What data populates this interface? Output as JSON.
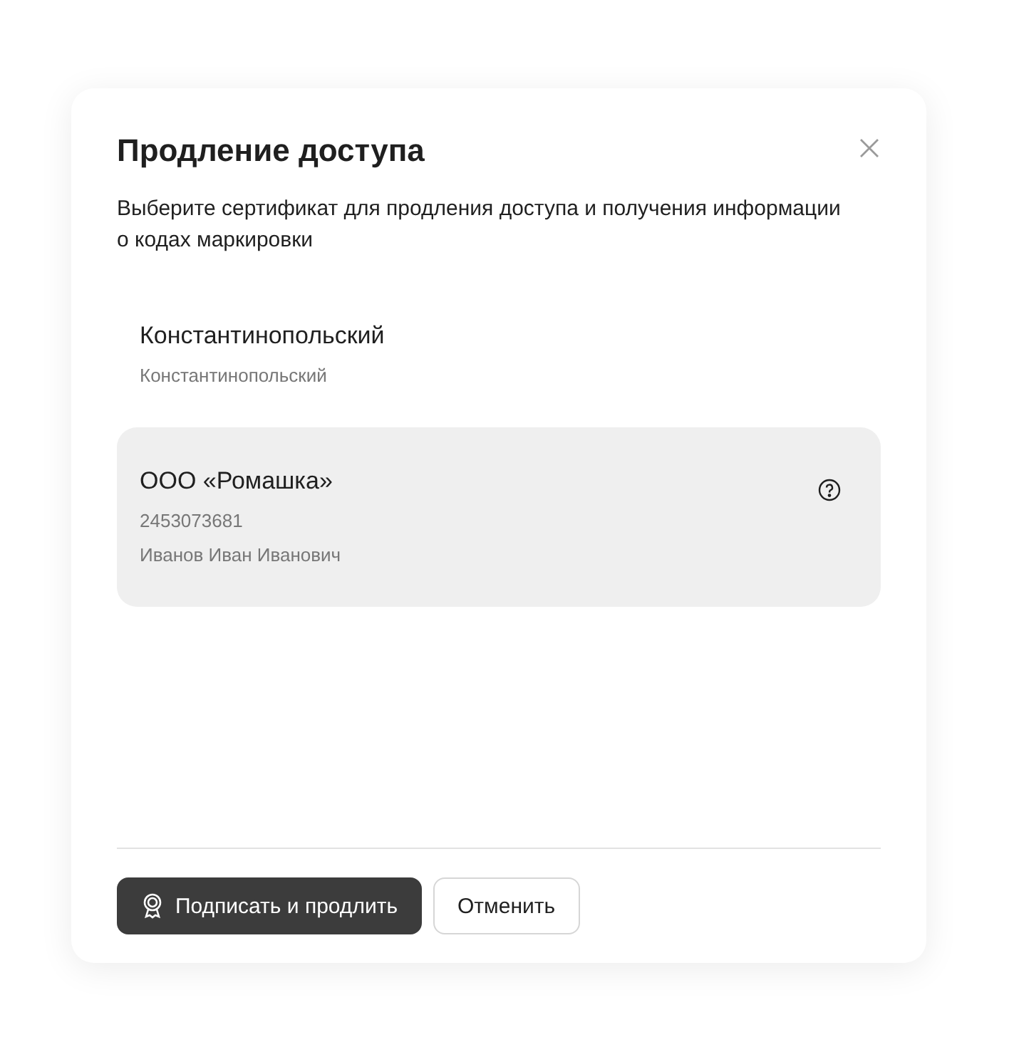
{
  "dialog": {
    "title": "Продление доступа",
    "description": "Выберите сертификат для продления доступа и получения информации о кодах маркировки"
  },
  "certificates": [
    {
      "name": "Константинопольский",
      "details": [
        "Константинопольский"
      ],
      "selected": false,
      "help": false
    },
    {
      "name": "ООО «Ромашка»",
      "details": [
        "2453073681",
        "Иванов Иван Иванович"
      ],
      "selected": true,
      "help": true
    }
  ],
  "buttons": [
    {
      "label": "Подписать и продлить",
      "kind": "primary"
    },
    {
      "label": "Отменить",
      "kind": "secondary"
    }
  ]
}
